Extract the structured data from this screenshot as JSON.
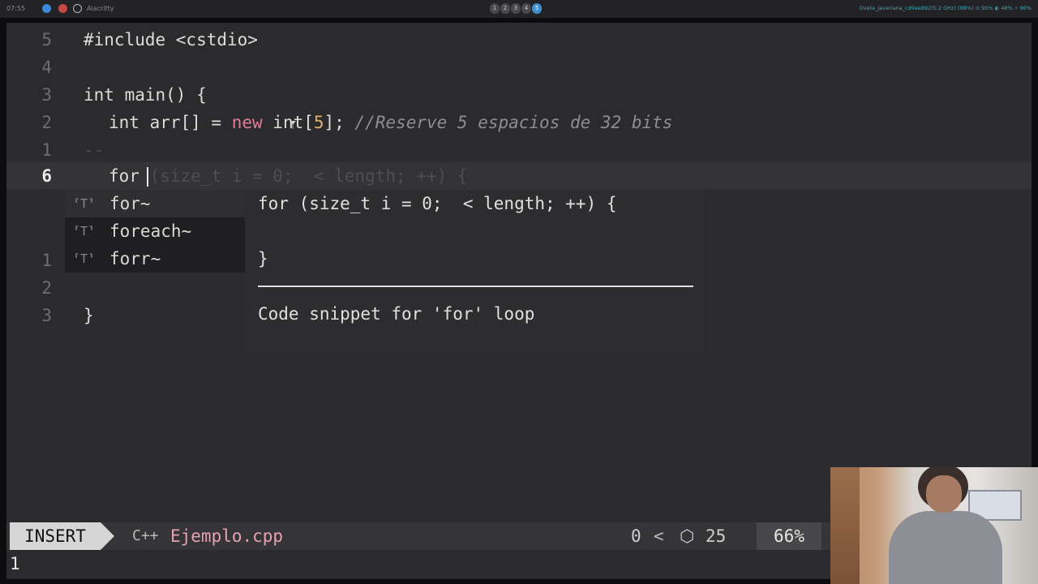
{
  "topbar": {
    "clock": "07:55",
    "app_name": "Alacritty",
    "workspaces": [
      "1",
      "2",
      "3",
      "4",
      "5"
    ],
    "active_workspace": "5",
    "status_text": "Oveta_Javeriana_cd9ee892(5.2 GHz) (98%)  ⊙ 95%  ◐ 48%  ⚡ 96%"
  },
  "editor": {
    "lines": [
      {
        "num": "5",
        "text": "#include <cstdio>"
      },
      {
        "num": "4",
        "text": ""
      },
      {
        "num": "3",
        "text": "int main() {"
      },
      {
        "num": "2",
        "text": "  int arr[] = new int[5]; //Reserve 5 espacios de 32 bits"
      },
      {
        "num": "1",
        "text": "--"
      },
      {
        "num": "6",
        "text": "  for"
      },
      {
        "num": "1",
        "text": ""
      },
      {
        "num": "2",
        "text": ""
      },
      {
        "num": "3",
        "text": "}"
      }
    ],
    "l2_pre": "int arr[] = ",
    "l2_new": "new",
    "l2_int": " int[",
    "l2_num": "5",
    "l2_end": "];",
    "l2_comment": "//Reserve 5 espacios de 32 bits",
    "current_line_text": "for",
    "ghost_text": " (size_t i = 0;  < length; ++) {",
    "last_line_text": "}"
  },
  "completion": {
    "items": [
      {
        "icon": "snippet-icon",
        "glyph": "⸢T⸣",
        "label": "for~"
      },
      {
        "icon": "snippet-icon",
        "glyph": "⸢T⸣",
        "label": "foreach~"
      },
      {
        "icon": "snippet-icon",
        "glyph": "⸢T⸣",
        "label": "forr~"
      }
    ],
    "selected_index": 0
  },
  "docs": {
    "line1": "for (size_t i = 0;  < length; ++) {",
    "line2": "",
    "line3": "}",
    "description": "Code snippet for 'for' loop"
  },
  "statusline": {
    "mode": "INSERT",
    "filetype_icon": "C++",
    "filename": "Ejemplo.cpp",
    "diagnostics": "0",
    "chevron": "<",
    "lsp_icon": "⬡",
    "lsp_count": "25",
    "percent": "66%"
  },
  "cmdline": "1",
  "colors": {
    "background": "#2b2b2d",
    "accent_pink": "#e6a0b4",
    "workspace_active": "#3f8fd0"
  }
}
